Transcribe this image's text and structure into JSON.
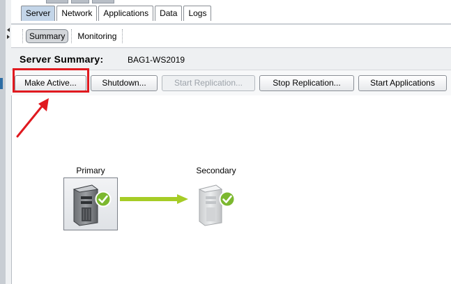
{
  "top_tabs": [
    {
      "label": "Server",
      "active": true
    },
    {
      "label": "Network",
      "active": false
    },
    {
      "label": "Applications",
      "active": false
    },
    {
      "label": "Data",
      "active": false
    },
    {
      "label": "Logs",
      "active": false
    }
  ],
  "sub_tabs": [
    {
      "label": "Summary",
      "active": true
    },
    {
      "label": "Monitoring",
      "active": false
    }
  ],
  "summary": {
    "title": "Server Summary:",
    "server_name": "BAG1-WS2019"
  },
  "toolbar": {
    "make_active": "Make Active...",
    "shutdown": "Shutdown...",
    "start_replication": "Start Replication...",
    "stop_replication": "Stop Replication...",
    "start_applications": "Start Applications"
  },
  "toolbar_state": {
    "start_replication_enabled": false
  },
  "diagram": {
    "primary_label": "Primary",
    "secondary_label": "Secondary",
    "primary_status": "check",
    "secondary_status": "check"
  },
  "colors": {
    "active_tab": "#c3d5e8",
    "highlight": "#e0191f",
    "replication_arrow": "#a6cc26",
    "status_check": "#7cb82f"
  },
  "icons": {
    "server": "server-tower-icon",
    "status": "check-circle-icon",
    "annotation_arrow": "red-arrow-icon"
  }
}
